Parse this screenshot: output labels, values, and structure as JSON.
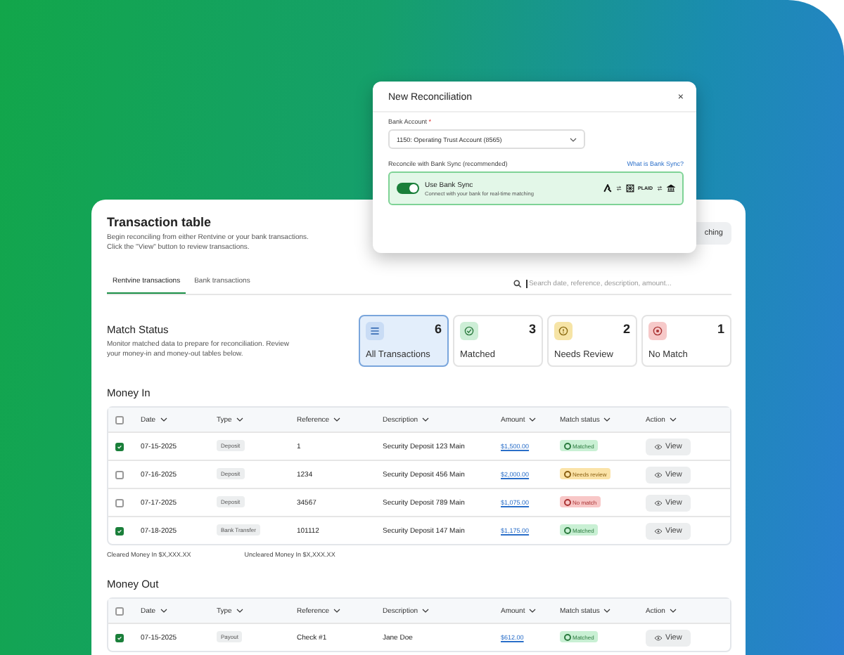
{
  "modal": {
    "title": "New Reconciliation",
    "close": "×",
    "bank_account_label": "Bank Account",
    "required_mark": "*",
    "bank_account_value": "1150: Operating Trust Account (8565)",
    "sync_label": "Reconcile with Bank Sync (recommended)",
    "help_link": "What is Bank Sync?",
    "toggle": {
      "on": true,
      "label": "Use Bank Sync",
      "description": "Connect with your bank for real-time matching"
    },
    "plaid": "PLAID"
  },
  "card": {
    "title": "Transaction table",
    "description": "Begin reconciling from either Rentvine or your bank transactions. Click the \"View\" button to review transactions.",
    "partial_button": "ching",
    "tabs": [
      {
        "label": "Rentvine transactions",
        "selected": true
      },
      {
        "label": "Bank transactions",
        "selected": false
      }
    ],
    "search": {
      "placeholder": "Search date, reference, description, amount..."
    },
    "match_status": {
      "title": "Match Status",
      "description": "Monitor matched data to prepare for reconciliation. Review your money-in and money-out tables below.",
      "filters": [
        {
          "kind": "all",
          "count": "6",
          "label": "All Transactions",
          "selected": true
        },
        {
          "kind": "matched",
          "count": "3",
          "label": "Matched",
          "selected": false
        },
        {
          "kind": "review",
          "count": "2",
          "label": "Needs Review",
          "selected": false
        },
        {
          "kind": "nomatch",
          "count": "1",
          "label": "No Match",
          "selected": false
        }
      ]
    },
    "sections": [
      {
        "title": "Money In",
        "header_checked": false,
        "columns": [
          "Date",
          "Type",
          "Reference",
          "Description",
          "Amount",
          "Match status",
          "Action"
        ],
        "rows": [
          {
            "checked": true,
            "date": "07-15-2025",
            "type": "Deposit",
            "reference": "1",
            "description": "Security Deposit 123 Main",
            "amount": "$1,500.00",
            "status": {
              "kind": "matched",
              "label": "Matched"
            },
            "action": "View"
          },
          {
            "checked": false,
            "date": "07-16-2025",
            "type": "Deposit",
            "reference": "1234",
            "description": "Security Deposit 456 Main",
            "amount": "$2,000.00",
            "status": {
              "kind": "review",
              "label": "Needs review"
            },
            "action": "View"
          },
          {
            "checked": false,
            "date": "07-17-2025",
            "type": "Deposit",
            "reference": "34567",
            "description": "Security Deposit 789 Main",
            "amount": "$1,075.00",
            "status": {
              "kind": "nomatch",
              "label": "No match"
            },
            "action": "View"
          },
          {
            "checked": true,
            "date": "07-18-2025",
            "type": "Bank Transfer",
            "reference": "101112",
            "description": "Security Deposit 147 Main",
            "amount": "$1,175.00",
            "status": {
              "kind": "matched",
              "label": "Matched"
            },
            "action": "View"
          }
        ],
        "totals": [
          "Cleared Money In $X,XXX.XX",
          "Uncleared Money In $X,XXX.XX"
        ]
      },
      {
        "title": "Money Out",
        "header_checked": false,
        "columns": [
          "Date",
          "Type",
          "Reference",
          "Description",
          "Amount",
          "Match status",
          "Action"
        ],
        "rows": [
          {
            "checked": true,
            "date": "07-15-2025",
            "type": "Payout",
            "reference": "Check #1",
            "description": "Jane Doe",
            "amount": "$612.00",
            "status": {
              "kind": "matched",
              "label": "Matched"
            },
            "action": "View"
          }
        ]
      }
    ]
  }
}
